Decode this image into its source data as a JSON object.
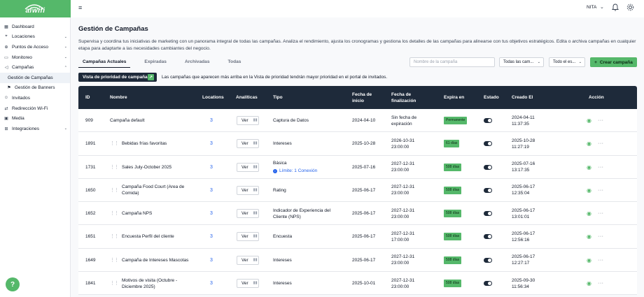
{
  "app": {
    "logo": "aiwifi"
  },
  "sidebar": {
    "items": [
      {
        "label": "Dashboard",
        "icon": "dashboard-icon",
        "expandable": false
      },
      {
        "label": "Locaciones",
        "icon": "location-icon",
        "expandable": true
      },
      {
        "label": "Puntos de Acceso",
        "icon": "access-point-icon",
        "expandable": true
      },
      {
        "label": "Monitoreo",
        "icon": "monitor-icon",
        "expandable": true
      },
      {
        "label": "Campañas",
        "icon": "campaign-icon",
        "expandable": true,
        "expanded": true
      }
    ],
    "subitems": [
      {
        "label": "Gestión de Campañas",
        "active": true
      },
      {
        "label": "Gestión de Banners",
        "active": false
      }
    ],
    "items_after": [
      {
        "label": "Invitados",
        "icon": "guests-icon",
        "expandable": false
      },
      {
        "label": "Redirección Wi-Fi",
        "icon": "redirect-icon",
        "expandable": false
      },
      {
        "label": "Media",
        "icon": "media-icon",
        "expandable": false
      },
      {
        "label": "Integraciones",
        "icon": "integrations-icon",
        "expandable": true
      }
    ],
    "help_label": "?"
  },
  "topbar": {
    "user": "NITA"
  },
  "page": {
    "title": "Gestión de Campañas",
    "description": "Supervisa y coordina tus iniciativas de marketing con un panorama integral de todas las campañas. Analiza el rendimiento, ajusta los cronogramas y gestiona los detalles de las campañas para alinearse con tus objetivos estratégicos. Edita o archiva campañas en cualquier etapa para adaptarte a las necesidades cambiantes del negocio."
  },
  "tabs": [
    "Campañas Actuales",
    "Expiradas",
    "Archivadas",
    "Todas"
  ],
  "filters": {
    "search_placeholder": "Nombre de la campaña",
    "type_filter": "Todas las cam...",
    "state_filter": "Todo el es...",
    "create_label": "Crear campaña"
  },
  "priority": {
    "button_label": "Vista de prioridad de campaña",
    "note": "Las campañas que aparecen más arriba en la Vista de prioridad tendrán mayor prioridad en el portal de invitados."
  },
  "table": {
    "columns": {
      "id": "ID",
      "name": "Nombre",
      "locations": "Locations",
      "analytics": "Analíticas",
      "type": "Tipo",
      "start": "Fecha de inicio",
      "end": "Fecha de finalización",
      "expires": "Expira en",
      "status": "Estado",
      "created": "Creado El",
      "action": "Acción"
    },
    "view_label": "Ver",
    "rows": [
      {
        "id": "909",
        "name": "Campaña default",
        "draggable": false,
        "locations": "3",
        "type": "Captura de Datos",
        "limit": "",
        "start": "2024-04-10",
        "end": "Sin fecha de expiración",
        "expires": "Permanente",
        "created": "2024-04-11 11:37:35",
        "enabled": true
      },
      {
        "id": "1891",
        "name": "Bebidas frías favoritas",
        "draggable": true,
        "locations": "3",
        "type": "Intereses",
        "limit": "",
        "start": "2025-10-28",
        "end": "2026-10-31 23:00:00",
        "expires": "61 días",
        "created": "2025-10-28 11:27:19",
        "enabled": true
      },
      {
        "id": "1731",
        "name": "Sales July-October 2025",
        "draggable": true,
        "locations": "3",
        "type": "Básica",
        "limit": "Límite: 1 Conexión",
        "start": "2025-07-16",
        "end": "2027-12-31 23:00:00",
        "expires": "508 días",
        "created": "2025-07-16 13:17:35",
        "enabled": true
      },
      {
        "id": "1650",
        "name": "Campaña Food Court (Area de Comida)",
        "draggable": true,
        "locations": "3",
        "type": "Rating",
        "limit": "",
        "start": "2025-06-17",
        "end": "2027-12-31 23:00:00",
        "expires": "508 días",
        "created": "2025-06-17 12:35:04",
        "enabled": true
      },
      {
        "id": "1652",
        "name": "Campaña NPS",
        "draggable": true,
        "locations": "3",
        "type": "Indicador de Experiencia del Cliente (NPS)",
        "limit": "",
        "start": "2025-06-17",
        "end": "2027-12-31 23:00:00",
        "expires": "508 días",
        "created": "2025-06-17 13:01:01",
        "enabled": true
      },
      {
        "id": "1651",
        "name": "Encuesta Perfil del cliente",
        "draggable": true,
        "locations": "3",
        "type": "Encuesta",
        "limit": "",
        "start": "2025-06-17",
        "end": "2027-12-31 17:00:00",
        "expires": "508 días",
        "created": "2025-06-17 12:56:16",
        "enabled": true
      },
      {
        "id": "1649",
        "name": "Campaña de Intereses Mascotas",
        "draggable": true,
        "locations": "3",
        "type": "Intereses",
        "limit": "",
        "start": "2025-06-17",
        "end": "2027-12-31 23:00:00",
        "expires": "508 días",
        "created": "2025-06-17 12:27:17",
        "enabled": true
      },
      {
        "id": "1841",
        "name": "Motivos de visita (Octubre - Diciembre 2025)",
        "draggable": true,
        "locations": "3",
        "type": "Intereses",
        "limit": "",
        "start": "2025-10-01",
        "end": "2027-12-31 23:00:00",
        "expires": "508 días",
        "created": "2025-09-30 11:56:34",
        "enabled": true
      }
    ]
  },
  "colors": {
    "brand": "#55b86a",
    "header": "#1e2a3a",
    "link": "#2563eb"
  }
}
